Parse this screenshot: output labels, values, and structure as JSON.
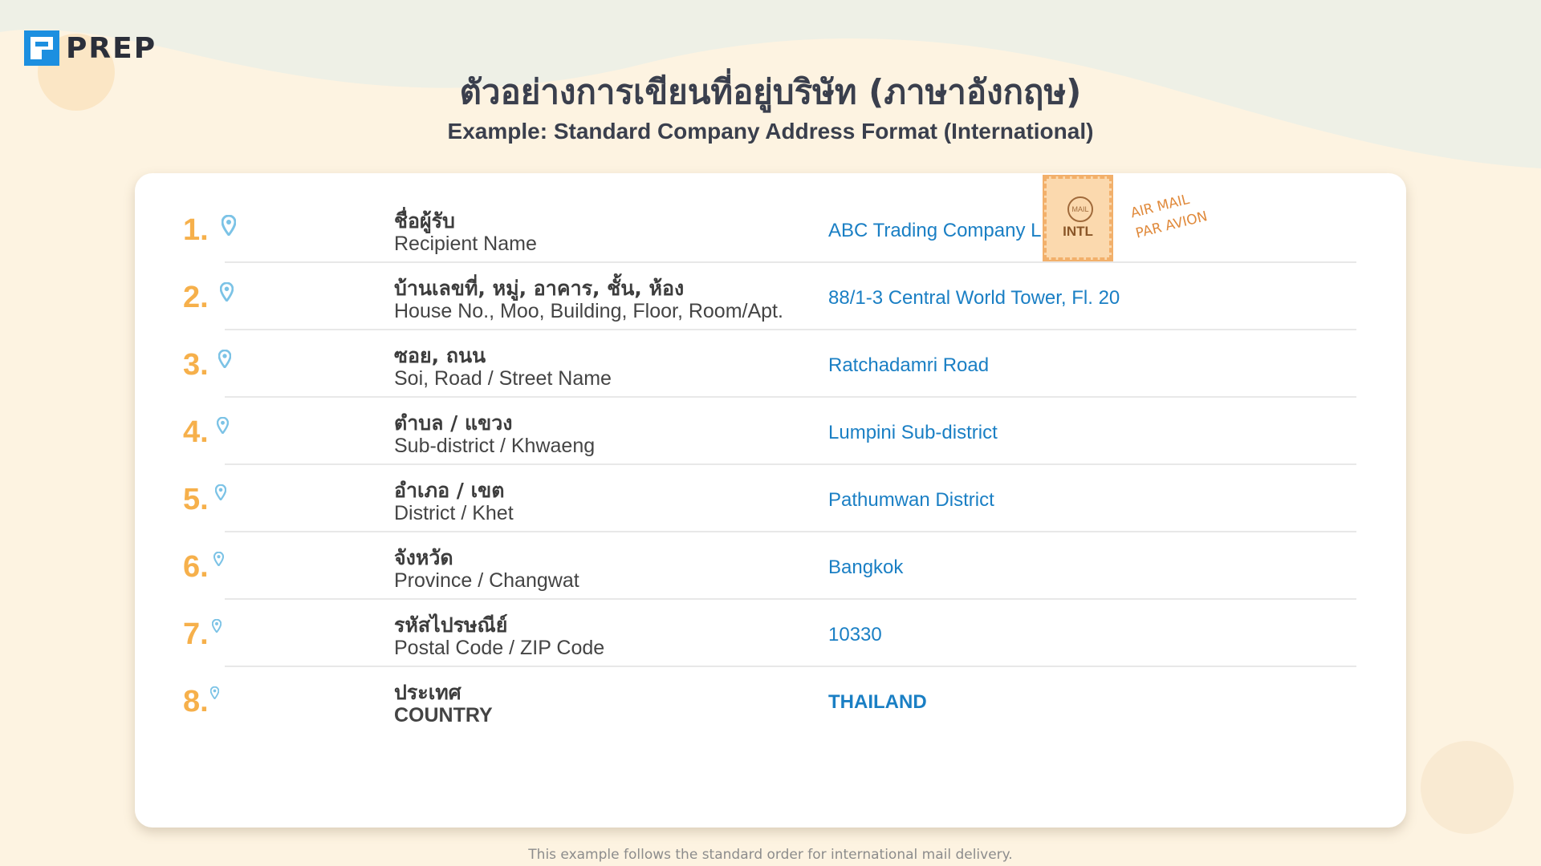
{
  "brand": {
    "name": "PREP",
    "logo_icon": "prep-logo-icon"
  },
  "header": {
    "title": "ตัวอย่างการเขียนที่อยู่บริษัท (ภาษาอังกฤษ)",
    "subtitle": "Example: Standard Company Address Format (International)"
  },
  "stamp": {
    "circle_text": "MAIL",
    "label": "INTL",
    "airmail_line1": "AIR MAIL",
    "airmail_line2": "PAR AVION"
  },
  "rows": [
    {
      "number": "1.",
      "label_th": "ชื่อผู้รับ",
      "label_en": "Recipient Name",
      "value": "ABC Trading Company Limited"
    },
    {
      "number": "2.",
      "label_th": "บ้านเลขที่, หมู่, อาคาร, ชั้น, ห้อง",
      "label_en": "House No., Moo, Building, Floor, Room/Apt.",
      "value": "88/1-3 Central World Tower, Fl. 20"
    },
    {
      "number": "3.",
      "label_th": "ซอย, ถนน",
      "label_en": "Soi, Road / Street Name",
      "value": "Ratchadamri Road"
    },
    {
      "number": "4.",
      "label_th": "ตำบล / แขวง",
      "label_en": "Sub-district / Khwaeng",
      "value": "Lumpini Sub-district"
    },
    {
      "number": "5.",
      "label_th": "อำเภอ / เขต",
      "label_en": "District / Khet",
      "value": "Pathumwan District"
    },
    {
      "number": "6.",
      "label_th": "จังหวัด",
      "label_en": "Province / Changwat",
      "value": "Bangkok"
    },
    {
      "number": "7.",
      "label_th": "รหัสไปรษณีย์",
      "label_en": "Postal Code / ZIP Code",
      "value": "10330"
    },
    {
      "number": "8.",
      "label_th": "ประเทศ",
      "label_en": "COUNTRY",
      "value": "THAILAND"
    }
  ],
  "footnote": "This example follows the standard order for international mail delivery.",
  "colors": {
    "accent_number": "#f6b04b",
    "value_text": "#1a7fc4",
    "pin": "#7cc3e6",
    "stamp": "#fbd9ae"
  }
}
